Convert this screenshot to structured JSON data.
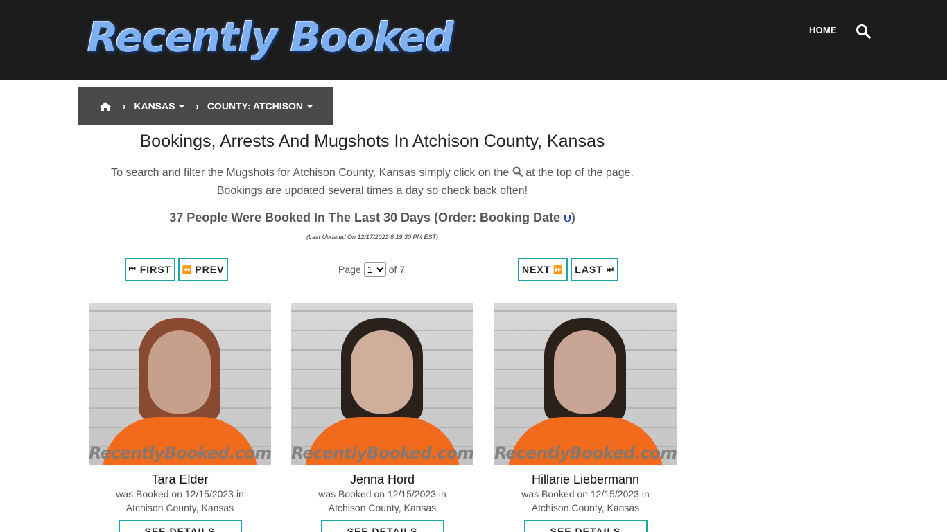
{
  "header": {
    "logo_text": "Recently Booked",
    "nav_home": "HOME",
    "search_icon": "search-icon"
  },
  "breadcrumb": {
    "home_icon": "home-icon",
    "state": "KANSAS",
    "county": "COUNTY: ATCHISON"
  },
  "main": {
    "title": "Bookings, Arrests And Mugshots In Atchison County, Kansas",
    "intro_before_icon": "To search and filter the Mugshots for Atchison County, Kansas simply click on the",
    "intro_after_icon": "at the top of the page.",
    "intro_line2": "Bookings are updated several times a day so check back often!",
    "count_text": "37 People Were Booked In The Last 30 Days (Order: Booking Date",
    "count_close": ")",
    "last_updated": "(Last Updated On 12/17/2023 8:19:30 PM EST)"
  },
  "pager": {
    "first": "FIRST",
    "prev": "PREV",
    "next": "NEXT",
    "last": "LAST",
    "page_label": "Page",
    "page_value": "1",
    "of_label": "of 7"
  },
  "cards": [
    {
      "name": "Tara Elder",
      "booked": "was Booked on 12/15/2023 in",
      "location": "Atchison County, Kansas",
      "watermark": "RecentlyBooked.com",
      "button": "SEE DETAILS",
      "hair": "#8a4a32"
    },
    {
      "name": "Jenna Hord",
      "booked": "was Booked on 12/15/2023 in",
      "location": "Atchison County, Kansas",
      "watermark": "RecentlyBooked.com",
      "button": "SEE DETAILS",
      "hair": "#2a211c"
    },
    {
      "name": "Hillarie Liebermann",
      "booked": "was Booked on 12/15/2023 in",
      "location": "Atchison County, Kansas",
      "watermark": "RecentlyBooked.com",
      "button": "SEE DETAILS",
      "hair": "#2b211b"
    }
  ],
  "colors": {
    "header_bg": "#1c1c1c",
    "breadcrumb_bg": "#4a4a4a",
    "accent": "#1aa6a6",
    "logo_blue": "#7fb0f0"
  }
}
